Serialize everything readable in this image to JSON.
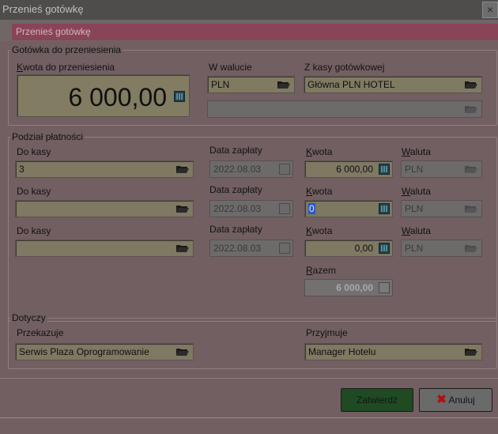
{
  "window": {
    "title": "Przenieś gotówkę",
    "close_glyph": "×"
  },
  "header": {
    "title": "Przenieś gotówkę"
  },
  "transfer_group": {
    "legend": "Gotówka do przeniesienia",
    "amount_label_first": "K",
    "amount_label_rest": "wota do przeniesienia",
    "amount_value": "6 000,00",
    "currency_label": "W walucie",
    "currency_value": "PLN",
    "cash_label": "Z kasy gotówkowej",
    "cash_value": "Główna PLN HOTEL"
  },
  "split_group": {
    "legend": "Podział płatności",
    "rows": [
      {
        "kasa_label": "Do kasy",
        "kasa_value": "3",
        "date_label": "Data zapłaty",
        "date_value": "2022.08.03",
        "kwota_first": "K",
        "kwota_rest": "wota",
        "kwota_value": "6 000,00",
        "waluta_first": "W",
        "waluta_rest": "aluta",
        "waluta_value": "PLN"
      },
      {
        "kasa_label": "Do kasy",
        "kasa_value": "",
        "date_label": "Data zapłaty",
        "date_value": "2022.08.03",
        "kwota_first": "K",
        "kwota_rest": "wota",
        "kwota_value": "0",
        "waluta_first": "W",
        "waluta_rest": "aluta",
        "waluta_value": "PLN"
      },
      {
        "kasa_label": "Do kasy",
        "kasa_value": "",
        "date_label": "Data zapłaty",
        "date_value": "2022.08.03",
        "kwota_first": "K",
        "kwota_rest": "wota",
        "kwota_value": "0,00",
        "waluta_first": "W",
        "waluta_rest": "aluta",
        "waluta_value": "PLN"
      }
    ],
    "total_first": "R",
    "total_rest": "azem",
    "total_value": "6 000,00"
  },
  "concerns_group": {
    "legend": "Dotyczy",
    "from_label": "Przekazuje",
    "from_value": "Serwis Plaza Oprogramowanie",
    "to_label": "Przyjmuje",
    "to_value": "Manager Hotelu"
  },
  "footer": {
    "confirm_label": "Zatwierdź",
    "cancel_label": "Anuluj",
    "cancel_glyph": "✖"
  },
  "colors": {
    "accent": "#8a4458",
    "confirm": "#1f4a22",
    "cancel_x": "#b01010"
  }
}
